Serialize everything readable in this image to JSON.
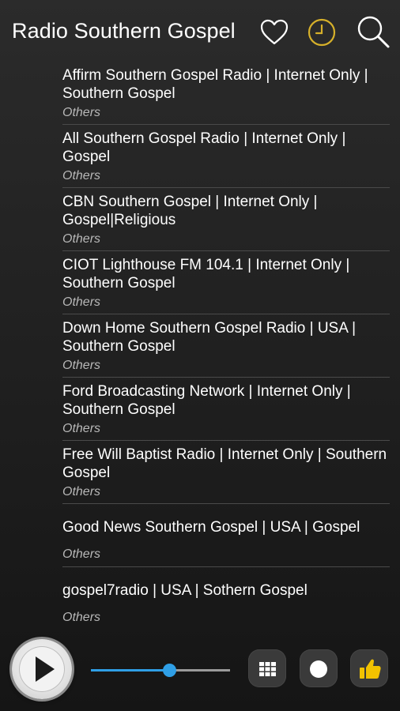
{
  "header": {
    "title": "Radio Southern Gospel",
    "icons": [
      "heart-icon",
      "clock-icon",
      "search-icon"
    ],
    "accent_color": "#d6b02a"
  },
  "stations": [
    {
      "title": "Affirm Southern Gospel Radio | Internet Only | Southern Gospel",
      "category": "Others"
    },
    {
      "title": "All Southern Gospel Radio | Internet Only | Gospel",
      "category": "Others"
    },
    {
      "title": "CBN Southern Gospel | Internet Only | Gospel|Religious",
      "category": "Others"
    },
    {
      "title": "CIOT Lighthouse FM 104.1 | Internet Only | Southern Gospel",
      "category": "Others"
    },
    {
      "title": "Down Home Southern Gospel Radio | USA | Southern Gospel",
      "category": "Others"
    },
    {
      "title": "Ford Broadcasting Network | Internet Only | Southern Gospel",
      "category": "Others"
    },
    {
      "title": "Free Will Baptist Radio | Internet Only | Southern Gospel",
      "category": "Others"
    },
    {
      "title": "Good News Southern Gospel | USA | Gospel",
      "category": "Others"
    },
    {
      "title": "gospel7radio | USA | Sothern Gospel",
      "category": "Others"
    }
  ],
  "player": {
    "volume_fraction": 0.56,
    "slider_color": "#2f9fe6",
    "controls": [
      "play-icon",
      "grid-icon",
      "record-icon",
      "thumbs-up-icon"
    ],
    "thumbs_color": "#f2c200"
  }
}
